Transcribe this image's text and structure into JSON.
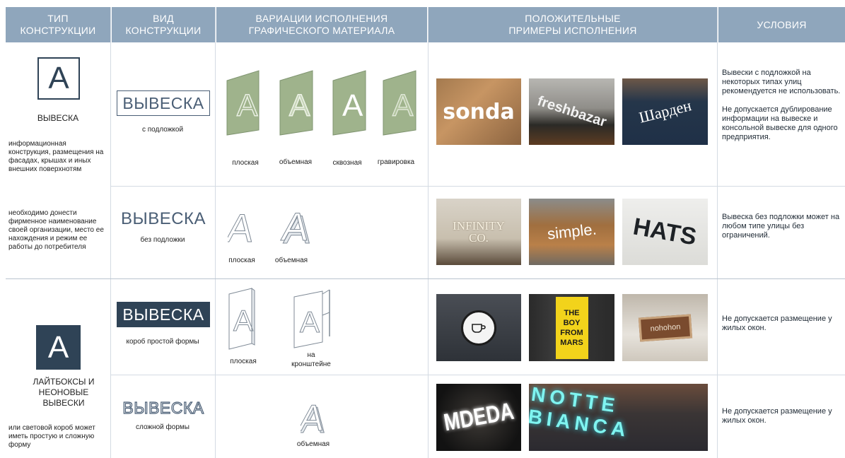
{
  "headers": {
    "type": "ТИП\nКОНСТРУКЦИИ",
    "kind": "ВИД\nКОНСТРУКЦИИ",
    "variations": "ВАРИАЦИИ ИСПОЛНЕНИЯ\nГРАФИЧЕСКОГО МАТЕРИАЛА",
    "examples": "ПОЛОЖИТЕЛЬНЫЕ\nПРИМЕРЫ ИСПОЛНЕНИЯ",
    "conditions": "УСЛОВИЯ"
  },
  "group1": {
    "icon_letter": "A",
    "title": "ВЫВЕСКА",
    "desc1": "информационная конструкция, размещения на фасадах, крышах и иных внешних поверхнотям",
    "desc2": "необходимо донести фирменное наименование своей организации, место ее нахождения и режим ее работы до потребителя",
    "row1": {
      "sign": "ВЫВЕСКА",
      "sign_caption": "с подложкой",
      "variants": [
        "плоская",
        "объемная",
        "сквозная",
        "гравировка"
      ],
      "letter": "A",
      "photos": [
        "sonda",
        "freshbazar",
        "Шардeн"
      ],
      "condition": "Вывески с подложкой на некоторых типах улиц рекомендуется не использовать.\n\nНе допускается дублирование информации на вывеске и консольной вывеске для одного предприятия."
    },
    "row2": {
      "sign": "ВЫВЕСКА",
      "sign_caption": "без подложки",
      "variants": [
        "плоская",
        "объемная"
      ],
      "letter": "A",
      "photos": [
        "INFINITY\nCO.",
        "simple.",
        "HATS"
      ],
      "condition": "Вывеска без подложки может на любом типе улицы без ограничений."
    }
  },
  "group2": {
    "icon_letter": "A",
    "title": "ЛАЙТБОКСЫ И НЕОНОВЫЕ ВЫВЕСКИ",
    "desc": "или световой короб может иметь простую и сложную форму",
    "row3": {
      "sign": "ВЫВЕСКА",
      "sign_caption": "короб простой формы",
      "variants": [
        "плоская",
        "на\nкронштейне"
      ],
      "letter": "A",
      "photos": [
        "",
        "THE\nBOY\nFROM\nMARS",
        "nohohon"
      ],
      "condition": "Не допускается размещение у жилых окон."
    },
    "row4": {
      "sign": "ВЫВЕСКА",
      "sign_caption": "сложной формы",
      "variants": [
        "объемная"
      ],
      "letter": "A",
      "photos": [
        "MDEDA",
        "NOTTE BIANCA"
      ],
      "condition": "Не допускается размещение у жилых окон."
    }
  },
  "colors": {
    "header": "#8fa6bc",
    "navy": "#2f4356",
    "panel_green": "#9fb38c",
    "grid": "#d4dbe3"
  }
}
